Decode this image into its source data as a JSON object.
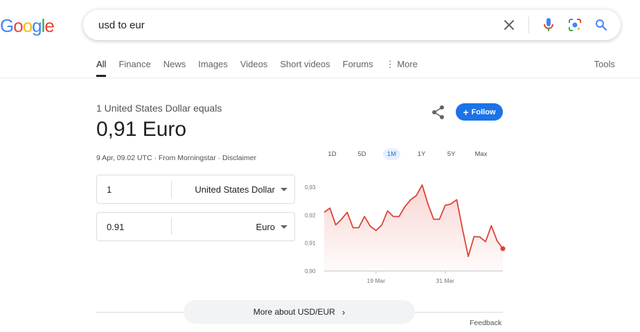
{
  "search": {
    "query": "usd to eur"
  },
  "logo": {
    "letters": [
      "G",
      "o",
      "o",
      "g",
      "l",
      "e"
    ],
    "colors": [
      "#4285f4",
      "#ea4335",
      "#fbbc05",
      "#4285f4",
      "#34a853",
      "#ea4335"
    ]
  },
  "tabs": [
    {
      "label": "All",
      "active": true
    },
    {
      "label": "Finance"
    },
    {
      "label": "News"
    },
    {
      "label": "Images"
    },
    {
      "label": "Videos"
    },
    {
      "label": "Short videos"
    },
    {
      "label": "Forums"
    },
    {
      "label": "⋮ More"
    }
  ],
  "tools_label": "Tools",
  "result": {
    "equals_text": "1 United States Dollar equals",
    "value_text": "0,91 Euro",
    "meta_text": "9 Apr, 09.02 UTC · From Morningstar · Disclaimer",
    "follow_label": "Follow",
    "follow_plus": "+",
    "from_amount": "1",
    "from_currency": "United States Dollar",
    "to_amount": "0.91",
    "to_currency": "Euro"
  },
  "ranges": [
    "1D",
    "5D",
    "1M",
    "1Y",
    "5Y",
    "Max"
  ],
  "active_range": "1M",
  "accent_color": "#1a73e8",
  "line_color": "#db4437",
  "chart_data": {
    "type": "area",
    "x": [
      0,
      1,
      2,
      3,
      4,
      5,
      6,
      7,
      8,
      9,
      10,
      11,
      12,
      13,
      14,
      15,
      16,
      17,
      18,
      19,
      20,
      21,
      22,
      23,
      24,
      25,
      26,
      27,
      28
    ],
    "values": [
      0.921,
      0.9225,
      0.9165,
      0.9185,
      0.921,
      0.9155,
      0.9155,
      0.9195,
      0.916,
      0.9145,
      0.9165,
      0.9215,
      0.9195,
      0.9195,
      0.923,
      0.9255,
      0.927,
      0.9308,
      0.924,
      0.9185,
      0.9185,
      0.9235,
      0.924,
      0.9255,
      0.915,
      0.9052,
      0.9123,
      0.9122,
      0.9105,
      0.9162,
      0.9108,
      0.908
    ],
    "ylim": [
      0.9,
      0.93
    ],
    "yticks": [
      "0,93",
      "0,92",
      "0,91",
      "0,90"
    ],
    "xticks": [
      "19 Mar",
      "31 Mar"
    ]
  },
  "more_about_label": "More about USD/EUR",
  "more_about_chevron": "›",
  "feedback_label": "Feedback"
}
